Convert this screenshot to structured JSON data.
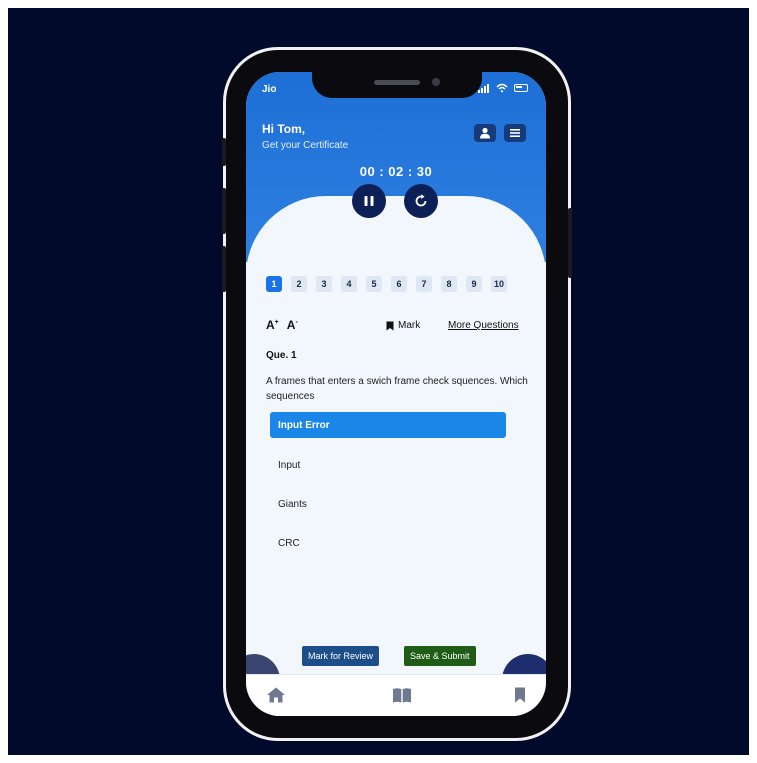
{
  "status_bar": {
    "carrier": "Jio"
  },
  "header": {
    "greeting": "Hi Tom,",
    "subtitle": "Get your Certificate",
    "profile_icon": "user-icon",
    "menu_icon": "menu-icon"
  },
  "timer": {
    "display": "00 : 02 : 30"
  },
  "controls": {
    "pause_icon": "pause-icon",
    "restart_icon": "restart-icon"
  },
  "question_numbers": [
    "1",
    "2",
    "3",
    "4",
    "5",
    "6",
    "7",
    "8",
    "9",
    "10"
  ],
  "active_question": "1",
  "toolbar": {
    "increase_font": "A",
    "decrease_font": "A",
    "mark_label": "Mark",
    "more_questions": "More Questions"
  },
  "question": {
    "label": "Que. 1",
    "text": "A frames that enters a swich frame  check squences. Which sequences",
    "options": [
      "Input Error",
      "Input",
      "Giants",
      "CRC"
    ],
    "selected_index": 0
  },
  "actions": {
    "review": "Mark for Review",
    "submit": "Save & Submit"
  },
  "navigation": {
    "prev_icon": "arrow-left-icon",
    "next_icon": "arrow-right-icon"
  },
  "tabbar": {
    "items": [
      "home-icon",
      "book-icon",
      "bookmark-icon"
    ]
  },
  "colors": {
    "background": "#020a2c",
    "header_blue": "#1e6fd6",
    "selected_option": "#1a86e8",
    "review_button": "#1c4e8a",
    "submit_button": "#1f5d16",
    "dark_control": "#0c1f57"
  }
}
